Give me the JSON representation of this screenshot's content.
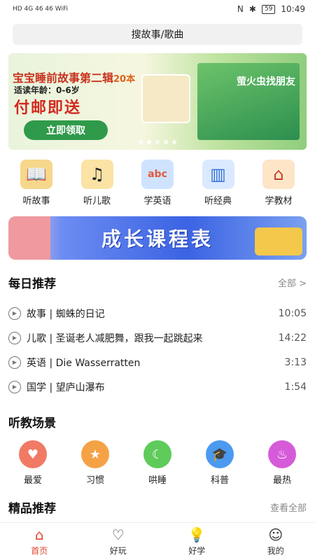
{
  "status": {
    "left": "HD 4G 46 46 WiFi",
    "time": "10:49",
    "battery": "59"
  },
  "search": {
    "placeholder": "搜故事/歌曲"
  },
  "banner": {
    "title": "宝宝睡前故事第二辑",
    "count": "20本",
    "age": "适读年龄：0-6岁",
    "free": "付邮即送",
    "claim_label": "立即领取",
    "book_title": "萤火虫找朋友",
    "page_count": 5,
    "active_index": 1
  },
  "categories": [
    {
      "label": "听故事",
      "icon": "book-reading-icon",
      "color": "#f6d78b"
    },
    {
      "label": "听儿歌",
      "icon": "music-duck-icon",
      "color": "#fbe3a6"
    },
    {
      "label": "学英语",
      "icon": "abc-blocks-icon",
      "color": "#cfe3ff"
    },
    {
      "label": "听经典",
      "icon": "classic-book-icon",
      "color": "#dbe9ff"
    },
    {
      "label": "学教材",
      "icon": "school-building-icon",
      "color": "#fde5c8"
    }
  ],
  "growth": {
    "label": "成长课程表"
  },
  "daily": {
    "title": "每日推荐",
    "more": "全部 >",
    "items": [
      {
        "title": "故事 | 蜘蛛的日记",
        "time": "10:05"
      },
      {
        "title": "儿歌 | 圣诞老人减肥舞，跟我一起跳起来",
        "time": "14:22"
      },
      {
        "title": "英语 | Die Wasserratten",
        "time": "3:13"
      },
      {
        "title": "国学 | 望庐山瀑布",
        "time": "1:54"
      }
    ]
  },
  "scenes": {
    "title": "听教场景",
    "items": [
      {
        "label": "最爱",
        "icon": "heart-icon",
        "color": "#f07a64"
      },
      {
        "label": "习惯",
        "icon": "star-icon",
        "color": "#f5a246"
      },
      {
        "label": "哄睡",
        "icon": "moon-icon",
        "color": "#5ecb5a"
      },
      {
        "label": "科普",
        "icon": "graduation-cap-icon",
        "color": "#4b9af0"
      },
      {
        "label": "最热",
        "icon": "fire-icon",
        "color": "#d65bd9"
      }
    ]
  },
  "premium": {
    "title": "精品推荐",
    "more": "查看全部"
  },
  "tabs": [
    {
      "label": "首页",
      "icon": "home-icon",
      "active": true
    },
    {
      "label": "好玩",
      "icon": "chat-heart-icon",
      "active": false
    },
    {
      "label": "好学",
      "icon": "lightbulb-icon",
      "active": false
    },
    {
      "label": "我的",
      "icon": "user-icon",
      "active": false
    }
  ]
}
